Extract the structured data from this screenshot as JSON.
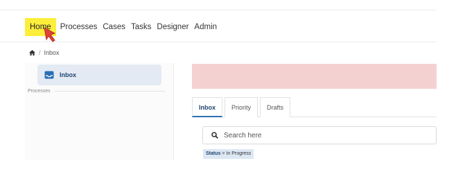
{
  "nav": {
    "items": [
      {
        "label": "Home",
        "active": true
      },
      {
        "label": "Processes"
      },
      {
        "label": "Cases"
      },
      {
        "label": "Tasks"
      },
      {
        "label": "Designer"
      },
      {
        "label": "Admin"
      }
    ],
    "highlight_color": "#fcee3a"
  },
  "breadcrumb": {
    "home_icon": "home-icon",
    "separator": "/",
    "current": "Inbox"
  },
  "sidebar": {
    "inbox_label": "Inbox",
    "inbox_icon": "inbox-icon",
    "section_label": "Processes"
  },
  "alert": {
    "color": "#f4d1d1"
  },
  "tabs": [
    {
      "label": "Inbox",
      "active": true
    },
    {
      "label": "Priority"
    },
    {
      "label": "Drafts"
    }
  ],
  "search": {
    "placeholder": "Search here",
    "icon": "search-icon"
  },
  "filter": {
    "key": "Status",
    "operator": "=",
    "value": "In Progress"
  },
  "cursor": {
    "icon": "pointer-cursor-icon",
    "color": "#e0443a"
  }
}
